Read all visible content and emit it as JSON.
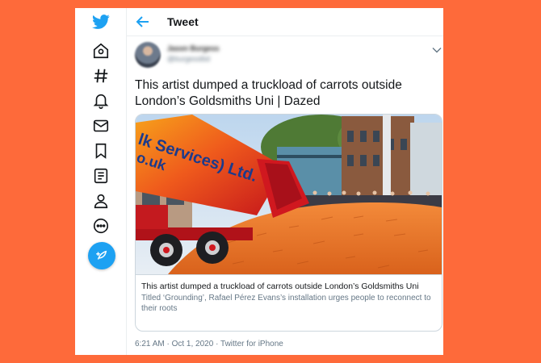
{
  "header": {
    "title": "Tweet"
  },
  "author": {
    "name": "Jason Burgess",
    "handle": "@burgesslbd"
  },
  "tweet": {
    "text_line1": "This artist dumped a truckload of carrots outside",
    "text_line2": "London’s Goldsmiths Uni | Dazed"
  },
  "card": {
    "title": "This artist dumped a truckload of carrots outside London’s Goldsmiths Uni",
    "description": "Titled ‘Grounding’, Rafael Pérez Evans’s installation urges people to reconnect to their roots",
    "truck_text_line1": "lk Services) Ltd.",
    "truck_text_line2": "o.uk"
  },
  "meta": {
    "time": "6:21 AM",
    "sep1": " · ",
    "date": "Oct 1, 2020",
    "sep2": " · ",
    "source": "Twitter for iPhone"
  },
  "colors": {
    "background": "#fe6a3a",
    "accent": "#1da1f2",
    "text": "#14171a",
    "muted": "#657786",
    "border": "#ccd6dd"
  },
  "icons": [
    "twitter-logo-icon",
    "home-icon",
    "hashtag-icon",
    "bell-icon",
    "mail-icon",
    "bookmark-icon",
    "list-icon",
    "profile-icon",
    "more-icon",
    "compose-icon",
    "back-arrow-icon",
    "chevron-down-icon"
  ]
}
